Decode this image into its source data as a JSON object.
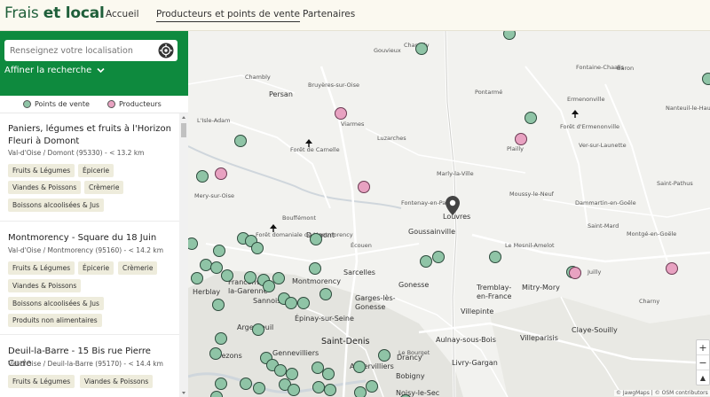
{
  "header": {
    "logo_part1": "Frais",
    "logo_part2": "et local",
    "nav": [
      "Accueil",
      "Producteurs et points de vente",
      "Partenaires"
    ]
  },
  "search": {
    "placeholder": "Renseignez votre localisation",
    "refine_label": "Affiner la recherche"
  },
  "legend": {
    "points_de_vente": "Points de vente",
    "producteurs": "Producteurs"
  },
  "colors": {
    "green": "#0e8a3e",
    "point_de_vente": "#8fc4a6",
    "producteur": "#e8a2c1"
  },
  "results": [
    {
      "title": "Paniers, légumes et fruits à l'Horizon Fleuri à Domont",
      "subtitle": "Val-d'Oise / Domont (95330) - < 13.2 km",
      "tags": [
        "Fruits & Légumes",
        "Épicerie",
        "Viandes & Poissons",
        "Crèmerie",
        "Boissons alcoolisées & Jus"
      ]
    },
    {
      "title": "Montmorency - Square du 18 Juin",
      "subtitle": "Val-d'Oise / Montmorency (95160) - < 14.2 km",
      "tags": [
        "Fruits & Légumes",
        "Épicerie",
        "Crèmerie",
        "Viandes & Poissons",
        "Boissons alcoolisées & Jus",
        "Produits non alimentaires"
      ]
    },
    {
      "title": "Deuil-la-Barre - 15 Bis rue Pierre Curie",
      "subtitle": "Val-d'Oise / Deuil-la-Barre (95170) - < 14.4 km",
      "tags": [
        "Fruits & Légumes",
        "Viandes & Poissons"
      ]
    }
  ],
  "map": {
    "places_small": [
      "Chambly",
      "Persan",
      "Bruyères-sur-Oise",
      "Gouvieux",
      "Chantilly",
      "Pontarmé",
      "Fontaine-Chaalis",
      "Baron",
      "Ermenonville",
      "L'Isle-Adam",
      "Viarmes",
      "Forêt de Carnelle",
      "Luzarches",
      "Forêt d'Ermenonville",
      "Nanteuil-le-Haudouin",
      "Marly-la-Ville",
      "Plailly",
      "Ver-sur-Launette",
      "Mery-sur-Oise",
      "Fontenay-en-Parisis",
      "Moussy-le-Neuf",
      "Saint-Pathus",
      "Bouffémont",
      "Forêt domaniale de Montmorency",
      "Dammartin-en-Goële",
      "Saint-Mard",
      "Montgé-en-Goële",
      "Écouen",
      "Le Mesnil-Amelot",
      "Juilly",
      "Charny",
      "Villeparisis",
      "Livry-Gargan",
      "Le Bourget",
      "Bobigny",
      "Noisy-le-Sec",
      "Villepinte",
      "Aulnay-sous-Bois",
      "Drancy",
      "Gennevilliers",
      "Herblay",
      "Bezons",
      "Argenteuil",
      "Épinay-sur-Seine",
      "Aubervilliers"
    ],
    "places_mid": [
      "Louvres",
      "Goussainville",
      "Sarcelles",
      "Gonesse",
      "Domont",
      "Montmorency",
      "Franconville-la-Garenne",
      "Sannois",
      "Garges-lès-Gonesse",
      "Tremblay-en-France",
      "Mitry-Mory",
      "Claye-Souilly",
      "Saint-Denis"
    ],
    "zoom_in": "+",
    "zoom_out": "−",
    "reset": "▲",
    "attribution": "© JawgMaps | © OSM contributors"
  }
}
